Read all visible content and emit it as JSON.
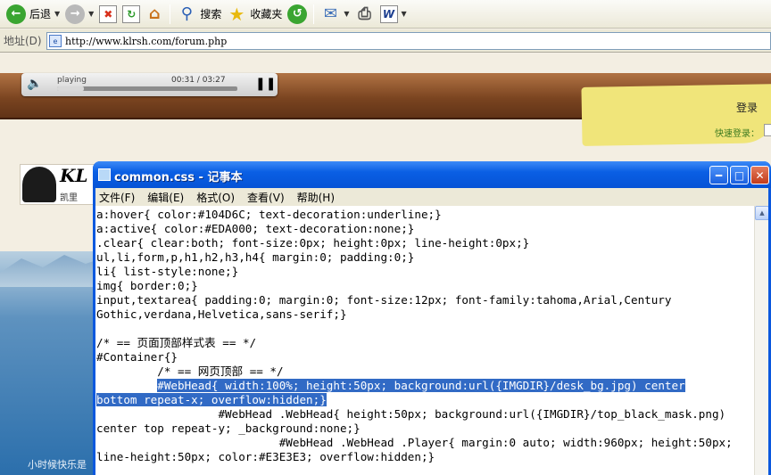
{
  "toolbar": {
    "back_label": "后退",
    "search_label": "搜索",
    "favorites_label": "收藏夹"
  },
  "address": {
    "label": "地址(D)",
    "url": "http://www.klrsh.com/forum.php"
  },
  "page": {
    "player": {
      "status": "playing",
      "time": "00:31 / 03:27",
      "progress": 0.15
    },
    "login": "登录",
    "quick_login": "快速登录：",
    "logo_text": "KL",
    "logo_sub": "凯里",
    "footer_text": "小时候快乐是"
  },
  "notepad": {
    "title": "common.css - 记事本",
    "menu": [
      "文件(F)",
      "编辑(E)",
      "格式(O)",
      "查看(V)",
      "帮助(H)"
    ],
    "lines": [
      "a:hover{ color:#104D6C; text-decoration:underline;}",
      "a:active{ color:#EDA000; text-decoration:none;}",
      ".clear{ clear:both; font-size:0px; height:0px; line-height:0px;}",
      "ul,li,form,p,h1,h2,h3,h4{ margin:0; padding:0;}",
      "li{ list-style:none;}",
      "img{ border:0;}",
      "input,textarea{ padding:0; margin:0; font-size:12px; font-family:tahoma,Arial,Century",
      "Gothic,verdana,Helvetica,sans-serif;}",
      "",
      "/* == 页面顶部样式表 == */",
      "#Container{}",
      "         /* == 网页顶部 == */",
      "         #WebHead{ width:100%; height:50px; background:url({IMGDIR}/desk_bg.jpg) center",
      "bottom repeat-x; overflow:hidden;}",
      "                  #WebHead .WebHead{ height:50px; background:url({IMGDIR}/top_black_mask.png)",
      "center top repeat-y; _background:none;}",
      "                           #WebHead .WebHead .Player{ margin:0 auto; width:960px; height:50px;",
      "line-height:50px; color:#E3E3E3; overflow:hidden;}"
    ]
  }
}
